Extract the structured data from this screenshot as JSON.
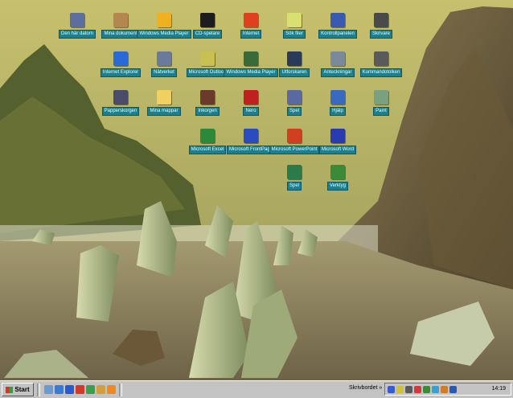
{
  "desktop_icons": [
    {
      "label": "Den här datorn",
      "icon": "computer-icon",
      "color": "#5b6e9c"
    },
    {
      "label": "Mina dokument",
      "icon": "person-icon",
      "color": "#b58650"
    },
    {
      "label": "Windows Media Player",
      "icon": "media-player-icon",
      "color": "#f0b020"
    },
    {
      "label": "CD-spelare",
      "icon": "cd-icon",
      "color": "#1d1d1d"
    },
    {
      "label": "Internet",
      "icon": "internet-icon",
      "color": "#e04020"
    },
    {
      "label": "Sök filer",
      "icon": "search-icon",
      "color": "#d8e070"
    },
    {
      "label": "Kontrollpanelen",
      "icon": "control-panel-icon",
      "color": "#3a5ab0"
    },
    {
      "label": "Skrivare",
      "icon": "printer-icon",
      "color": "#4a4a4a"
    },
    {
      "label": "Internet Explorer",
      "icon": "internet-explorer-icon",
      "color": "#2a6ad8"
    },
    {
      "label": "Nätverket",
      "icon": "network-icon",
      "color": "#6a7a9a"
    },
    {
      "label": "Microsoft Outlook",
      "icon": "outlook-icon",
      "color": "#c8c050"
    },
    {
      "label": "Windows Media Player",
      "icon": "media-icon",
      "color": "#3a6a3a"
    },
    {
      "label": "Utforskaren",
      "icon": "explorer-icon",
      "color": "#2a3a5a"
    },
    {
      "label": "Anteckningar",
      "icon": "notepad-icon",
      "color": "#7a8a9a"
    },
    {
      "label": "Kommandotolken",
      "icon": "command-prompt-icon",
      "color": "#5a5a5a"
    },
    {
      "label": "Papperskorgen",
      "icon": "recycle-bin-icon",
      "color": "#4a4a6a"
    },
    {
      "label": "Mina mappar",
      "icon": "folder-icon",
      "color": "#f0d060"
    },
    {
      "label": "Inkorgen",
      "icon": "inbox-icon",
      "color": "#6a3a2a"
    },
    {
      "label": "Nero",
      "icon": "nero-icon",
      "color": "#c02020"
    },
    {
      "label": "Spel",
      "icon": "games-icon",
      "color": "#5a6aa0"
    },
    {
      "label": "Hjälp",
      "icon": "help-icon",
      "color": "#3a6ac0"
    },
    {
      "label": "Paint",
      "icon": "paint-icon",
      "color": "#7aa080"
    },
    {
      "label": "Microsoft Excel",
      "icon": "excel-icon",
      "color": "#2a8a3a"
    },
    {
      "label": "Microsoft FrontPage",
      "icon": "frontpage-icon",
      "color": "#2a4ac0"
    },
    {
      "label": "Microsoft PowerPoint",
      "icon": "powerpoint-icon",
      "color": "#d04020"
    },
    {
      "label": "Microsoft Word",
      "icon": "word-icon",
      "color": "#2a3ab0"
    },
    {
      "label": "Spel",
      "icon": "game-icon",
      "color": "#2a7a4a"
    },
    {
      "label": "Verktyg",
      "icon": "tools-icon",
      "color": "#3a8a3a"
    }
  ],
  "taskbar": {
    "start_label": "Start",
    "quick_launch": [
      {
        "icon": "desktop-icon",
        "color": "#6a9ad0"
      },
      {
        "icon": "outlook-express-icon",
        "color": "#3a7ad0"
      },
      {
        "icon": "internet-explorer-icon",
        "color": "#2a5ad0"
      },
      {
        "icon": "media-player-icon",
        "color": "#d03a2a"
      },
      {
        "icon": "channels-icon",
        "color": "#3aa04a"
      },
      {
        "icon": "mail-icon",
        "color": "#d0a03a"
      },
      {
        "icon": "media-play-icon",
        "color": "#f08a20"
      }
    ],
    "tray_label": "Skrivbordet »",
    "tray_icons": [
      {
        "icon": "network-tray-icon",
        "color": "#3a5ad0"
      },
      {
        "icon": "volume-tray-icon",
        "color": "#d0c03a"
      },
      {
        "icon": "printer-tray-icon",
        "color": "#5a5a5a"
      },
      {
        "icon": "antivirus-tray-icon",
        "color": "#d03a3a"
      },
      {
        "icon": "modem-tray-icon",
        "color": "#3a8a3a"
      },
      {
        "icon": "messenger-tray-icon",
        "color": "#3aa0d0"
      },
      {
        "icon": "update-tray-icon",
        "color": "#d07a2a"
      },
      {
        "icon": "display-tray-icon",
        "color": "#2a5ab0"
      }
    ],
    "clock": "14:19"
  }
}
